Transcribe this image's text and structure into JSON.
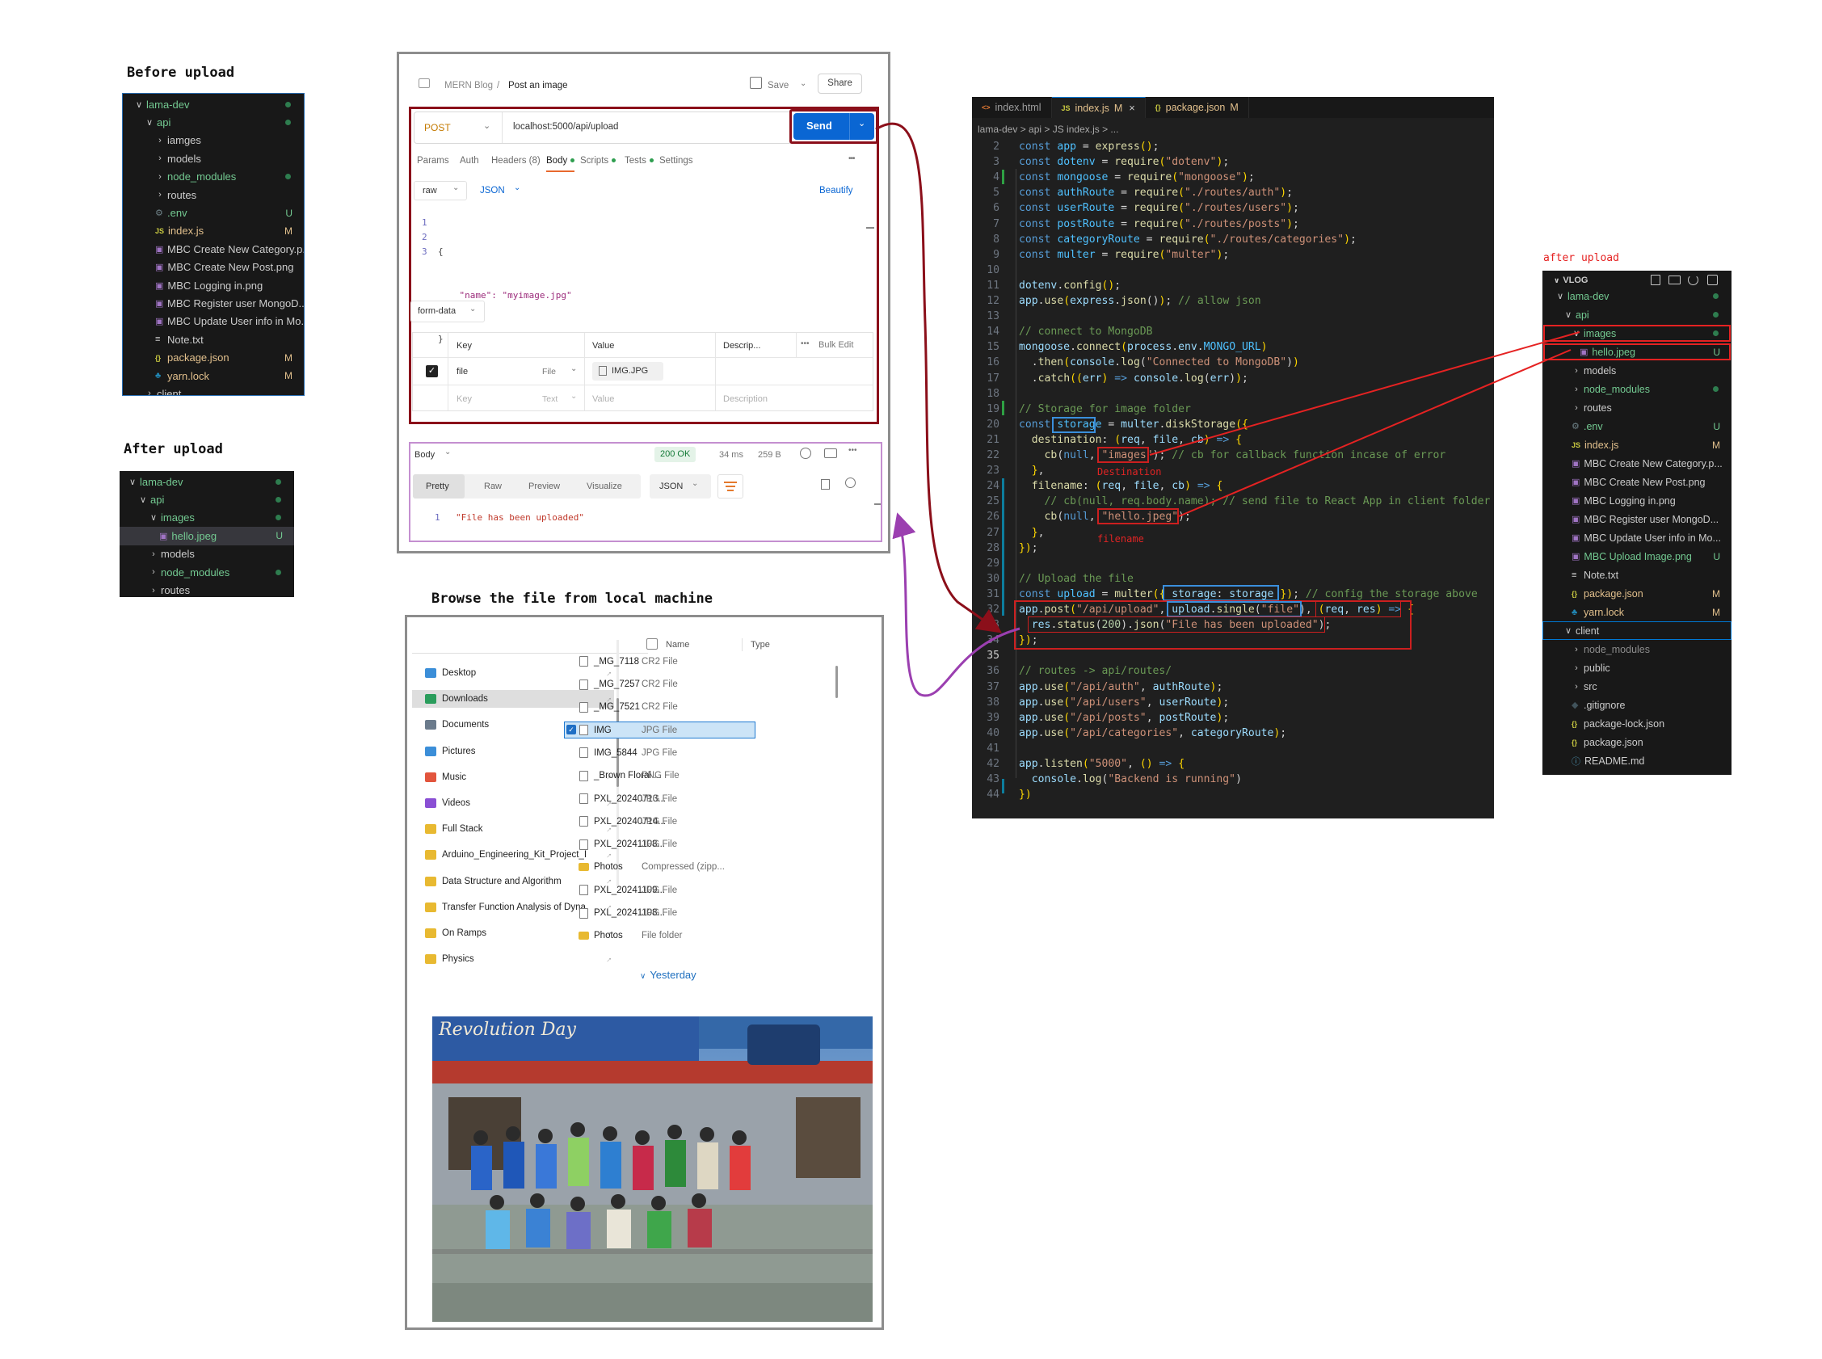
{
  "captions": {
    "before_upload": "Before upload",
    "after_upload": "After upload",
    "browse": "Browse the file from local machine",
    "after_upload_right": "after upload",
    "destination": "Destination",
    "filename": "filename"
  },
  "before_tree": [
    {
      "label": "lama-dev",
      "depth": 0,
      "chev": "∨",
      "color": "#73c991",
      "dot": true
    },
    {
      "label": "api",
      "depth": 1,
      "chev": "∨",
      "color": "#73c991",
      "dot": true
    },
    {
      "label": "iamges",
      "depth": 2,
      "chev": "›",
      "color": "#cccccc"
    },
    {
      "label": "models",
      "depth": 2,
      "chev": "›",
      "color": "#cccccc"
    },
    {
      "label": "node_modules",
      "depth": 2,
      "chev": "›",
      "color": "#73c991",
      "dot": true
    },
    {
      "label": "routes",
      "depth": 2,
      "chev": "›",
      "color": "#cccccc"
    },
    {
      "label": ".env",
      "depth": 2,
      "icon": "⚙",
      "iconColor": "#6d8086",
      "color": "#73c991",
      "badge": "U"
    },
    {
      "label": "index.js",
      "depth": 2,
      "icon": "JS",
      "iconColor": "#cbcb41",
      "color": "#e2c08d",
      "badge": "M"
    },
    {
      "label": "MBC Create New Category.p...",
      "depth": 2,
      "icon": "▣",
      "iconColor": "#a074c4",
      "color": "#cccccc"
    },
    {
      "label": "MBC Create New Post.png",
      "depth": 2,
      "icon": "▣",
      "iconColor": "#a074c4",
      "color": "#cccccc"
    },
    {
      "label": "MBC Logging in.png",
      "depth": 2,
      "icon": "▣",
      "iconColor": "#a074c4",
      "color": "#cccccc"
    },
    {
      "label": "MBC Register user MongoD...",
      "depth": 2,
      "icon": "▣",
      "iconColor": "#a074c4",
      "color": "#cccccc"
    },
    {
      "label": "MBC Update User info in Mo...",
      "depth": 2,
      "icon": "▣",
      "iconColor": "#a074c4",
      "color": "#cccccc"
    },
    {
      "label": "Note.txt",
      "depth": 2,
      "icon": "≡",
      "iconColor": "#cccccc",
      "color": "#cccccc"
    },
    {
      "label": "package.json",
      "depth": 2,
      "icon": "{}",
      "iconColor": "#cbcb41",
      "color": "#e2c08d",
      "badge": "M"
    },
    {
      "label": "yarn.lock",
      "depth": 2,
      "icon": "♣",
      "iconColor": "#2188b6",
      "color": "#e2c08d",
      "badge": "M"
    },
    {
      "label": "client",
      "depth": 1,
      "chev": "›",
      "color": "#cccccc"
    }
  ],
  "after_tree": [
    {
      "label": "lama-dev",
      "depth": 0,
      "chev": "∨",
      "color": "#73c991",
      "dot": true
    },
    {
      "label": "api",
      "depth": 1,
      "chev": "∨",
      "color": "#73c991",
      "dot": true
    },
    {
      "label": "images",
      "depth": 2,
      "chev": "∨",
      "color": "#73c991",
      "dot": true
    },
    {
      "label": "hello.jpeg",
      "depth": 3,
      "icon": "▣",
      "iconColor": "#a074c4",
      "color": "#73c991",
      "badge": "U",
      "selected": true
    },
    {
      "label": "models",
      "depth": 2,
      "chev": "›",
      "color": "#cccccc"
    },
    {
      "label": "node_modules",
      "depth": 2,
      "chev": "›",
      "color": "#73c991",
      "dot": true
    },
    {
      "label": "routes",
      "depth": 2,
      "chev": "›",
      "color": "#cccccc"
    }
  ],
  "vlog_tree": [
    {
      "label": "lama-dev",
      "depth": 1,
      "chev": "∨",
      "color": "#73c991",
      "dot": true
    },
    {
      "label": "api",
      "depth": 2,
      "chev": "∨",
      "color": "#73c991",
      "dot": true
    },
    {
      "label": "images",
      "depth": 3,
      "chev": "∨",
      "color": "#73c991",
      "dot": true,
      "boxed": true
    },
    {
      "label": "hello.jpeg",
      "depth": 4,
      "icon": "▣",
      "iconColor": "#a074c4",
      "color": "#73c991",
      "badge": "U",
      "boxed": true
    },
    {
      "label": "models",
      "depth": 3,
      "chev": "›",
      "color": "#cccccc"
    },
    {
      "label": "node_modules",
      "depth": 3,
      "chev": "›",
      "color": "#73c991",
      "dot": true
    },
    {
      "label": "routes",
      "depth": 3,
      "chev": "›",
      "color": "#cccccc"
    },
    {
      "label": ".env",
      "depth": 3,
      "icon": "⚙",
      "iconColor": "#6d8086",
      "color": "#73c991",
      "badge": "U"
    },
    {
      "label": "index.js",
      "depth": 3,
      "icon": "JS",
      "iconColor": "#cbcb41",
      "color": "#e2c08d",
      "badge": "M"
    },
    {
      "label": "MBC Create New Category.p...",
      "depth": 3,
      "icon": "▣",
      "iconColor": "#a074c4",
      "color": "#cccccc"
    },
    {
      "label": "MBC Create New Post.png",
      "depth": 3,
      "icon": "▣",
      "iconColor": "#a074c4",
      "color": "#cccccc"
    },
    {
      "label": "MBC Logging in.png",
      "depth": 3,
      "icon": "▣",
      "iconColor": "#a074c4",
      "color": "#cccccc"
    },
    {
      "label": "MBC Register user MongoD...",
      "depth": 3,
      "icon": "▣",
      "iconColor": "#a074c4",
      "color": "#cccccc"
    },
    {
      "label": "MBC Update User info in Mo...",
      "depth": 3,
      "icon": "▣",
      "iconColor": "#a074c4",
      "color": "#cccccc"
    },
    {
      "label": "MBC Upload Image.png",
      "depth": 3,
      "icon": "▣",
      "iconColor": "#a074c4",
      "color": "#73c991",
      "badge": "U"
    },
    {
      "label": "Note.txt",
      "depth": 3,
      "icon": "≡",
      "iconColor": "#cccccc",
      "color": "#cccccc"
    },
    {
      "label": "package.json",
      "depth": 3,
      "icon": "{}",
      "iconColor": "#cbcb41",
      "color": "#e2c08d",
      "badge": "M"
    },
    {
      "label": "yarn.lock",
      "depth": 3,
      "icon": "♣",
      "iconColor": "#2188b6",
      "color": "#e2c08d",
      "badge": "M"
    },
    {
      "label": "client",
      "depth": 2,
      "chev": "∨",
      "color": "#cccccc",
      "focused": true
    },
    {
      "label": "node_modules",
      "depth": 3,
      "chev": "›",
      "color": "#8c8c8c"
    },
    {
      "label": "public",
      "depth": 3,
      "chev": "›",
      "color": "#cccccc"
    },
    {
      "label": "src",
      "depth": 3,
      "chev": "›",
      "color": "#cccccc"
    },
    {
      "label": ".gitignore",
      "depth": 3,
      "icon": "◆",
      "iconColor": "#41535b",
      "color": "#cccccc"
    },
    {
      "label": "package-lock.json",
      "depth": 3,
      "icon": "{}",
      "iconColor": "#cbcb41",
      "color": "#cccccc"
    },
    {
      "label": "package.json",
      "depth": 3,
      "icon": "{}",
      "iconColor": "#cbcb41",
      "color": "#cccccc"
    },
    {
      "label": "README.md",
      "depth": 3,
      "icon": "ⓘ",
      "iconColor": "#519aba",
      "color": "#cccccc"
    },
    {
      "label": "yarn.lock",
      "depth": 3,
      "icon": "♣",
      "iconColor": "#2188b6",
      "color": "#cccccc"
    }
  ],
  "vlog": {
    "title": "VLOG",
    "icons": [
      "new-file-icon",
      "new-folder-icon",
      "refresh-icon",
      "collapse-icon"
    ]
  },
  "postman": {
    "breadcrumb_root": "MERN Blog",
    "breadcrumb_sep": "/",
    "request_name": "Post an image",
    "save": "Save",
    "share": "Share",
    "method": "POST",
    "url": "localhost:5000/api/upload",
    "send": "Send",
    "tabs": [
      "Params",
      "Auth",
      "Headers (8)",
      "Body",
      "Scripts",
      "Tests",
      "Settings"
    ],
    "more": "•••",
    "body_mode": "raw",
    "body_lang": "JSON",
    "beautify": "Beautify",
    "raw_lines": [
      "{",
      "    \"name\": \"myimage.jpg\"",
      "}"
    ],
    "form_data": "form-data",
    "table_headers": [
      "Key",
      "Value",
      "Descrip...",
      "Bulk Edit"
    ],
    "row_key": "file",
    "row_type": "File",
    "row_value": "IMG.JPG",
    "placeholder_key": "Key",
    "placeholder_type": "Text",
    "placeholder_value": "Value",
    "placeholder_desc": "Description",
    "resp_body": "Body",
    "status": "200 OK",
    "time": "34 ms",
    "size": "259 B",
    "resp_tabs": [
      "Pretty",
      "Raw",
      "Preview",
      "Visualize"
    ],
    "resp_lang": "JSON",
    "resp_line": "\"File has been uploaded\""
  },
  "editor": {
    "tabs": [
      {
        "label": "index.html",
        "icon": "<>",
        "iconColor": "#e37933",
        "status": "",
        "active": false
      },
      {
        "label": "index.js",
        "icon": "JS",
        "iconColor": "#cbcb41",
        "status": "M",
        "active": true
      },
      {
        "label": "package.json",
        "icon": "{}",
        "iconColor": "#cbcb41",
        "status": "M",
        "active": false
      }
    ],
    "close": "×",
    "breadcrumb": "lama-dev > api > JS index.js > ...",
    "lines": [
      {
        "n": "2",
        "html": "<span class='k'>const</span> <span class='v'>app</span> = <span class='f'>express</span><span class='p'>()</span>;"
      },
      {
        "n": "3",
        "html": "<span class='k'>const</span> <span class='v'>dotenv</span> = <span class='f'>require</span><span class='p'>(</span><span class='s'>\"dotenv\"</span><span class='p'>)</span>;"
      },
      {
        "n": "4",
        "html": "<span class='k'>const</span> <span class='v'>mongoose</span> = <span class='f'>require</span><span class='p'>(</span><span class='s'>\"mongoose\"</span><span class='p'>)</span>;"
      },
      {
        "n": "5",
        "html": "<span class='k'>const</span> <span class='v'>authRoute</span> = <span class='f'>require</span><span class='p'>(</span><span class='s'>\"./routes/auth\"</span><span class='p'>)</span>;"
      },
      {
        "n": "6",
        "html": "<span class='k'>const</span> <span class='v'>userRoute</span> = <span class='f'>require</span><span class='p'>(</span><span class='s'>\"./routes/users\"</span><span class='p'>)</span>;"
      },
      {
        "n": "7",
        "html": "<span class='k'>const</span> <span class='v'>postRoute</span> = <span class='f'>require</span><span class='p'>(</span><span class='s'>\"./routes/posts\"</span><span class='p'>)</span>;"
      },
      {
        "n": "8",
        "html": "<span class='k'>const</span> <span class='v'>categoryRoute</span> = <span class='f'>require</span><span class='p'>(</span><span class='s'>\"./routes/categories\"</span><span class='p'>)</span>;"
      },
      {
        "n": "9",
        "html": "<span class='k'>const</span> <span class='v'>multer</span> = <span class='f'>require</span><span class='p'>(</span><span class='s'>\"multer\"</span><span class='p'>)</span>;"
      },
      {
        "n": "10",
        "html": ""
      },
      {
        "n": "11",
        "html": "<span class='w'>dotenv</span>.<span class='f'>config</span><span class='p'>()</span>;"
      },
      {
        "n": "12",
        "html": "<span class='w'>app</span>.<span class='f'>use</span><span class='p'>(</span><span class='w'>express</span>.<span class='f'>json</span>()<span class='p'>)</span>; <span class='c'>// allow json</span>"
      },
      {
        "n": "13",
        "html": ""
      },
      {
        "n": "14",
        "html": "<span class='c'>// connect to MongoDB</span>"
      },
      {
        "n": "15",
        "html": "<span class='w'>mongoose</span>.<span class='f'>connect</span><span class='p'>(</span><span class='w'>process</span>.<span class='w'>env</span>.<span class='v'>MONGO_URL</span><span class='p'>)</span>"
      },
      {
        "n": "16",
        "html": "  .<span class='f'>then</span><span class='p'>(</span><span class='w'>console</span>.<span class='f'>log</span>(<span class='s'>\"Connected to MongoDB\"</span>)<span class='p'>)</span>"
      },
      {
        "n": "17",
        "html": "  .<span class='f'>catch</span><span class='p'>((</span><span class='w'>err</span><span class='p'>)</span> <span class='k'>=&gt;</span> <span class='w'>console</span>.<span class='f'>log</span>(<span class='w'>err</span>)<span class='p'>)</span>;"
      },
      {
        "n": "18",
        "html": ""
      },
      {
        "n": "19",
        "html": "<span class='c'>// Storage for image folder</span>"
      },
      {
        "n": "20",
        "html": "<span class='k'>const</span> <span class='v'>storage</span> = <span class='w'>multer</span>.<span class='f'>diskStorage</span><span class='p'>({</span>"
      },
      {
        "n": "21",
        "html": "  <span class='f'>destination</span>: <span class='p'>(</span><span class='w'>req</span>, <span class='w'>file</span>, <span class='w'>cb</span><span class='p'>)</span> <span class='k'>=&gt;</span> <span class='p'>{</span>"
      },
      {
        "n": "22",
        "html": "    <span class='f'>cb</span>(<span class='k'>null</span>, <span class='s'>\"images\"</span>); <span class='c'>// cb for callback function incase of error</span>"
      },
      {
        "n": "23",
        "html": "  <span class='p'>}</span>,"
      },
      {
        "n": "24",
        "html": "  <span class='f'>filename</span>: <span class='p'>(</span><span class='w'>req</span>, <span class='w'>file</span>, <span class='w'>cb</span><span class='p'>)</span> <span class='k'>=&gt;</span> <span class='p'>{</span>"
      },
      {
        "n": "25",
        "html": "    <span class='c'>// cb(null, req.body.name); // send file to React App in client folder u</span>"
      },
      {
        "n": "26",
        "html": "    <span class='f'>cb</span>(<span class='k'>null</span>, <span class='s'>\"hello.jpeg\"</span>);"
      },
      {
        "n": "27",
        "html": "  <span class='p'>}</span>,"
      },
      {
        "n": "28",
        "html": "<span class='p'>})</span>;"
      },
      {
        "n": "29",
        "html": ""
      },
      {
        "n": "30",
        "html": "<span class='c'>// Upload the file</span>"
      },
      {
        "n": "31",
        "html": "<span class='k'>const</span> <span class='v'>upload</span> = <span class='f'>multer</span><span class='p'>({</span> <span class='w'>storage</span>: <span class='w'>storage</span> <span class='p'>})</span>; <span class='c'>// config the storage above</span>"
      },
      {
        "n": "32",
        "html": "<span class='w'>app</span>.<span class='f'>post</span><span class='p'>(</span><span class='s'>\"/api/upload\"</span>, <span class='w'>upload</span>.<span class='f'>single</span>(<span class='s'>\"file\"</span>), <span class='p'>(</span><span class='w'>req</span>, <span class='w'>res</span><span class='p'>)</span> <span class='k'>=&gt;</span> <span class='p'>{</span>"
      },
      {
        "n": "33",
        "html": "  <span class='w'>res</span>.<span class='f'>status</span>(<span class='n'>200</span>).<span class='f'>json</span>(<span class='s'>\"File has been uploaded\"</span>);"
      },
      {
        "n": "34",
        "html": "<span class='p'>})</span>;"
      },
      {
        "n": "35",
        "html": ""
      },
      {
        "n": "36",
        "html": "<span class='c'>// routes -&gt; api/routes/</span>"
      },
      {
        "n": "37",
        "html": "<span class='w'>app</span>.<span class='f'>use</span><span class='p'>(</span><span class='s'>\"/api/auth\"</span>, <span class='w'>authRoute</span><span class='p'>)</span>;"
      },
      {
        "n": "38",
        "html": "<span class='w'>app</span>.<span class='f'>use</span><span class='p'>(</span><span class='s'>\"/api/users\"</span>, <span class='w'>userRoute</span><span class='p'>)</span>;"
      },
      {
        "n": "39",
        "html": "<span class='w'>app</span>.<span class='f'>use</span><span class='p'>(</span><span class='s'>\"/api/posts\"</span>, <span class='w'>postRoute</span><span class='p'>)</span>;"
      },
      {
        "n": "40",
        "html": "<span class='w'>app</span>.<span class='f'>use</span><span class='p'>(</span><span class='s'>\"/api/categories\"</span>, <span class='w'>categoryRoute</span><span class='p'>)</span>;"
      },
      {
        "n": "41",
        "html": ""
      },
      {
        "n": "42",
        "html": "<span class='w'>app</span>.<span class='f'>listen</span><span class='p'>(</span><span class='s'>\"5000\"</span>, <span class='p'>()</span> <span class='k'>=&gt;</span> <span class='p'>{</span>"
      },
      {
        "n": "43",
        "html": "  <span class='w'>console</span>.<span class='f'>log</span>(<span class='s'>\"Backend is running\"</span>)"
      },
      {
        "n": "44",
        "html": "<span class='p'>})</span>"
      }
    ]
  },
  "browser": {
    "quick_access": [
      {
        "label": "Desktop",
        "color": "#3b8ed8"
      },
      {
        "label": "Downloads",
        "color": "#2a9d5c",
        "selected": true
      },
      {
        "label": "Documents",
        "color": "#6b7b8c"
      },
      {
        "label": "Pictures",
        "color": "#3b8ed8"
      },
      {
        "label": "Music",
        "color": "#e2553d"
      },
      {
        "label": "Videos",
        "color": "#8a4fd4"
      },
      {
        "label": "Full Stack",
        "color": "#e8b931"
      },
      {
        "label": "Arduino_Engineering_Kit_Project_I",
        "color": "#e8b931"
      },
      {
        "label": "Data Structure and Algorithm",
        "color": "#e8b931"
      },
      {
        "label": "Transfer Function Analysis of Dyna",
        "color": "#e8b931"
      },
      {
        "label": "On Ramps",
        "color": "#e8b931"
      },
      {
        "label": "Physics",
        "color": "#e8b931"
      }
    ],
    "pin": "📌",
    "col_name": "Name",
    "col_type": "Type",
    "files": [
      {
        "name": "_MG_7118",
        "type": "CR2 File"
      },
      {
        "name": "_MG_7257",
        "type": "CR2 File"
      },
      {
        "name": "_MG_7521",
        "type": "CR2 File"
      },
      {
        "name": "IMG",
        "type": "JPG File",
        "selected": true
      },
      {
        "name": "IMG_5844",
        "type": "JPG File"
      },
      {
        "name": "_Brown Floral ...",
        "type": "PNG File"
      },
      {
        "name": "PXL_20240713...",
        "type": "JPG File"
      },
      {
        "name": "PXL_20240714...",
        "type": "JPG File"
      },
      {
        "name": "PXL_20241108...",
        "type": "JPG File"
      },
      {
        "name": "Photos",
        "type": "Compressed (zipp...",
        "folder": true
      },
      {
        "name": "PXL_20241109...",
        "type": "JPG File"
      },
      {
        "name": "PXL_20241108...",
        "type": "JPG File"
      },
      {
        "name": "Photos",
        "type": "File folder",
        "folder": true
      }
    ],
    "group": "Yesterday",
    "photo_text": "Revolution Day"
  }
}
